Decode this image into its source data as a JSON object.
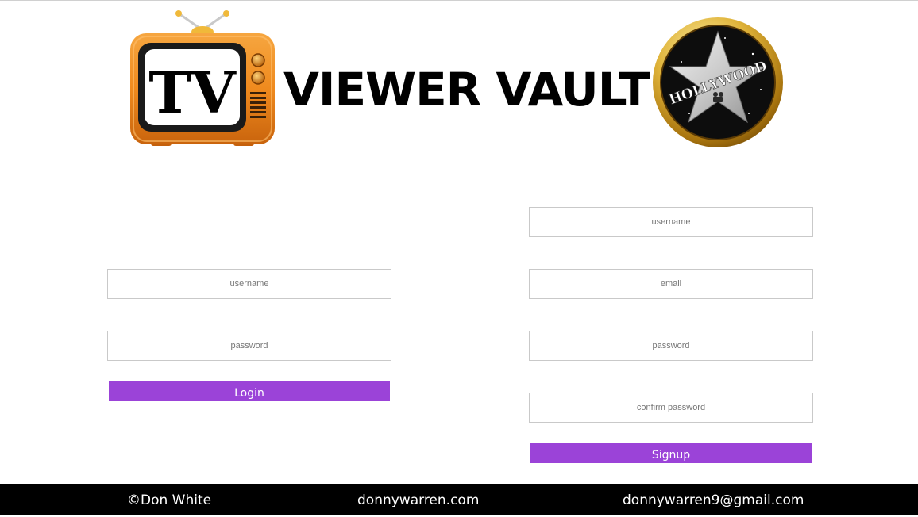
{
  "header": {
    "tv_logo_text": "TV",
    "title": "VIEWER VAULT",
    "hollywood_logo_text": "HOLLYWOOD"
  },
  "login": {
    "username_placeholder": "username",
    "password_placeholder": "password",
    "button_label": "Login"
  },
  "signup": {
    "username_placeholder": "username",
    "email_placeholder": "email",
    "password_placeholder": "password",
    "confirm_password_placeholder": "confirm password",
    "button_label": "Signup"
  },
  "footer": {
    "copyright": "©Don White",
    "website": "donnywarren.com",
    "email": "donnywarren9@gmail.com"
  },
  "colors": {
    "button": "#9b43d8",
    "footer_bg": "#000000",
    "tv_orange": "#f08a1c"
  }
}
